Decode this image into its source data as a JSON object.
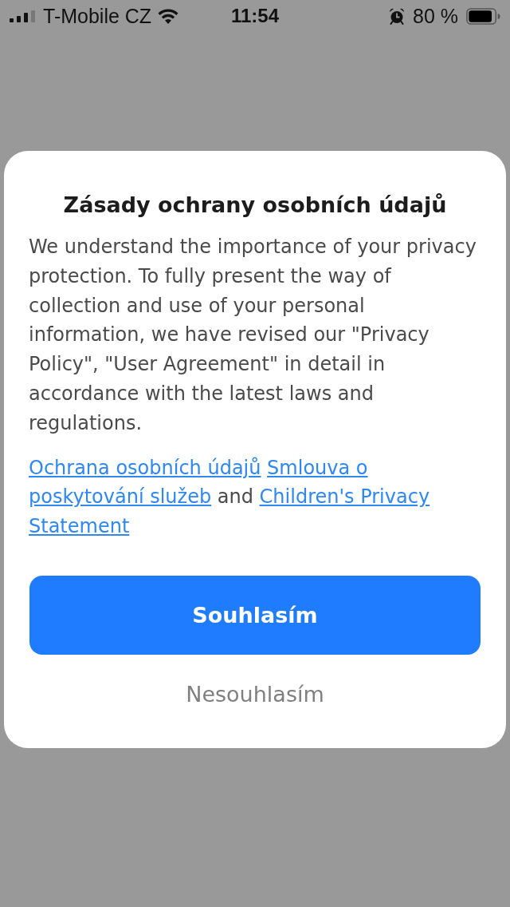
{
  "status_bar": {
    "carrier": "T-Mobile CZ",
    "time": "11:54",
    "battery": "80 %"
  },
  "dialog": {
    "title": "Zásady ochrany osobních údajů",
    "body": "We understand the importance of your privacy protection. To fully present the way of collection and use of your personal information, we have revised our \"Privacy Policy\", \"User Agreement\" in detail in accordance with the latest laws and regulations.",
    "links": [
      {
        "kind": "link",
        "text": "Ochrana osobních údajů"
      },
      {
        "kind": "link",
        "text": "Smlouva o"
      },
      {
        "kind": "link",
        "text": "poskytování služeb"
      },
      {
        "kind": "text",
        "text": "and"
      },
      {
        "kind": "link",
        "text": "Children's Privacy"
      },
      {
        "kind": "link",
        "text": "Statement"
      }
    ],
    "buttons": [
      {
        "kind": "primary",
        "label": "Souhlasím"
      },
      {
        "kind": "plain",
        "label": "Nesouhlasím"
      }
    ]
  }
}
